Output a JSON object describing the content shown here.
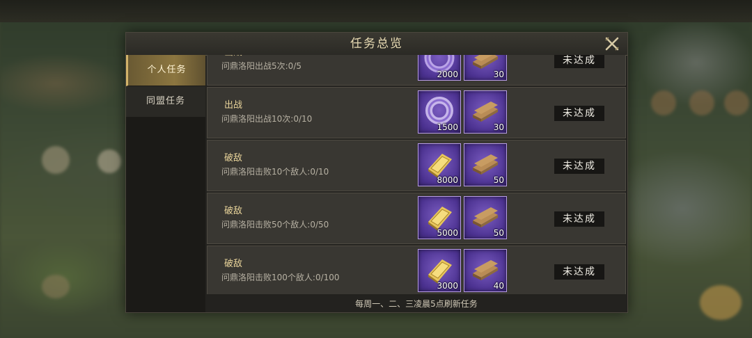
{
  "dialog": {
    "title": "任务总览",
    "close_icon": "close-x-icon"
  },
  "tabs": [
    {
      "label": "个人任务",
      "active": true
    },
    {
      "label": "同盟任务",
      "active": false
    }
  ],
  "tasks": [
    {
      "name": "出战",
      "description": "问鼎洛阳出战5次:0/5",
      "rewards": [
        {
          "icon": "jade-ring-icon",
          "qty": "2000"
        },
        {
          "icon": "wood-plank-icon",
          "qty": "30"
        }
      ],
      "status": "未达成"
    },
    {
      "name": "出战",
      "description": "问鼎洛阳出战10次:0/10",
      "rewards": [
        {
          "icon": "jade-ring-icon",
          "qty": "1500"
        },
        {
          "icon": "wood-plank-icon",
          "qty": "30"
        }
      ],
      "status": "未达成"
    },
    {
      "name": "破敌",
      "description": "问鼎洛阳击败10个敌人:0/10",
      "rewards": [
        {
          "icon": "gold-ingot-icon",
          "qty": "8000"
        },
        {
          "icon": "wood-plank-icon",
          "qty": "50"
        }
      ],
      "status": "未达成"
    },
    {
      "name": "破敌",
      "description": "问鼎洛阳击败50个敌人:0/50",
      "rewards": [
        {
          "icon": "gold-ingot-icon",
          "qty": "5000"
        },
        {
          "icon": "wood-plank-icon",
          "qty": "50"
        }
      ],
      "status": "未达成"
    },
    {
      "name": "破敌",
      "description": "问鼎洛阳击败100个敌人:0/100",
      "rewards": [
        {
          "icon": "gold-ingot-icon",
          "qty": "3000"
        },
        {
          "icon": "wood-plank-icon",
          "qty": "40"
        }
      ],
      "status": "未达成"
    }
  ],
  "footer": {
    "note": "每周一、二、三凌晨5点刷新任务"
  },
  "colors": {
    "accent_gold": "#d2b36a",
    "reward_purple": "#5b3fa3",
    "panel_bg": "#23221f"
  }
}
